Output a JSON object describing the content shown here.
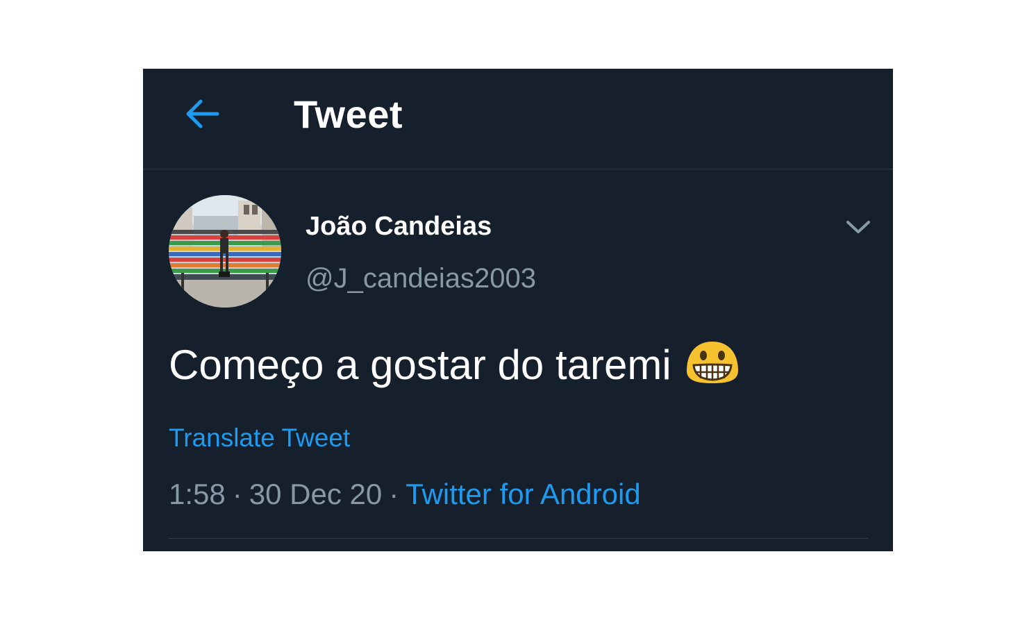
{
  "header": {
    "back_icon": "arrow-left-icon",
    "title": "Tweet"
  },
  "tweet": {
    "author_name": "João Candeias",
    "author_handle": "@J_candeias2003",
    "text": "Começo a gostar do taremi",
    "emoji": "grinning-face-icon",
    "translate_label": "Translate Tweet",
    "time": "1:58",
    "date": "30 Dec 20",
    "separator": "·",
    "source": "Twitter for Android",
    "menu_icon": "chevron-down-icon"
  },
  "colors": {
    "background": "#16202c",
    "accent": "#1d9bf0",
    "secondary_text": "#8899a6",
    "primary_text": "#ffffff",
    "divider": "#2f3b47"
  }
}
